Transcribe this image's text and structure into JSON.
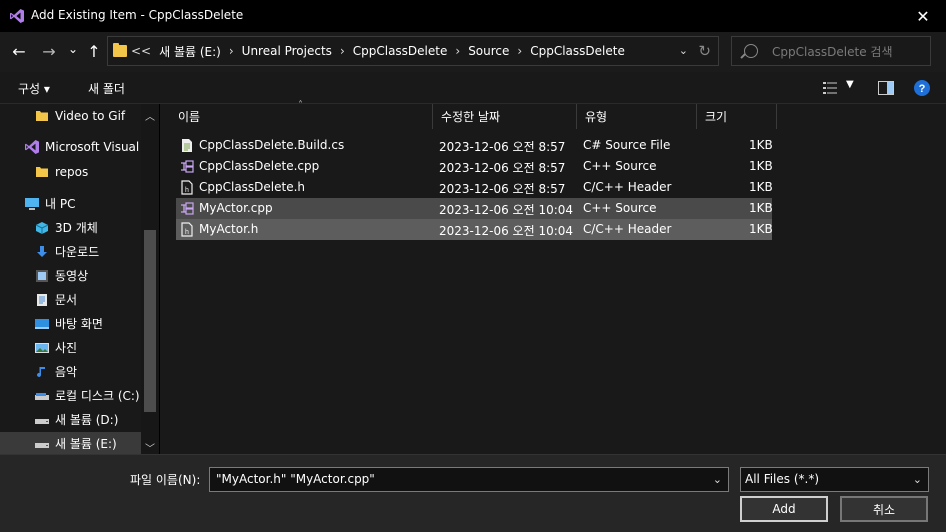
{
  "window": {
    "title": "Add Existing Item - CppClassDelete",
    "close": "✕"
  },
  "nav": {
    "back": "←",
    "forward": "→",
    "recent": "⌄",
    "up": "↑",
    "breadcrumb": [
      "<<",
      "새 볼륨 (E:)",
      "Unreal Projects",
      "CppClassDelete",
      "Source",
      "CppClassDelete"
    ],
    "search_placeholder": "CppClassDelete 검색"
  },
  "toolbar": {
    "organize": "구성 ▾",
    "new_folder": "새 폴더"
  },
  "sidebar": {
    "items": [
      {
        "label": "Video to Gif",
        "icon": "folder-icon"
      },
      {
        "label": "Microsoft Visual S",
        "icon": "vs-icon"
      },
      {
        "label": "repos",
        "icon": "folder-icon"
      },
      {
        "label": "내 PC",
        "icon": "pc-icon"
      },
      {
        "label": "3D 개체",
        "icon": "cube-icon"
      },
      {
        "label": "다운로드",
        "icon": "download-icon"
      },
      {
        "label": "동영상",
        "icon": "video-icon"
      },
      {
        "label": "문서",
        "icon": "document-icon"
      },
      {
        "label": "바탕 화면",
        "icon": "desktop-icon"
      },
      {
        "label": "사진",
        "icon": "picture-icon"
      },
      {
        "label": "음악",
        "icon": "music-icon"
      },
      {
        "label": "로컬 디스크 (C:)",
        "icon": "drive-icon"
      },
      {
        "label": "새 볼륨 (D:)",
        "icon": "drive-icon"
      },
      {
        "label": "새 볼륨 (E:)",
        "icon": "drive-icon"
      }
    ]
  },
  "columns": {
    "name": "이름",
    "date": "수정한 날짜",
    "type": "유형",
    "size": "크기"
  },
  "files": [
    {
      "name": "CppClassDelete.Build.cs",
      "date": "2023-12-06 오전 8:57",
      "type": "C# Source File",
      "size": "1KB",
      "icon": "cs-file-icon"
    },
    {
      "name": "CppClassDelete.cpp",
      "date": "2023-12-06 오전 8:57",
      "type": "C++ Source",
      "size": "1KB",
      "icon": "cpp-file-icon"
    },
    {
      "name": "CppClassDelete.h",
      "date": "2023-12-06 오전 8:57",
      "type": "C/C++ Header",
      "size": "1KB",
      "icon": "h-file-icon"
    },
    {
      "name": "MyActor.cpp",
      "date": "2023-12-06 오전 10:04",
      "type": "C++ Source",
      "size": "1KB",
      "icon": "cpp-file-icon"
    },
    {
      "name": "MyActor.h",
      "date": "2023-12-06 오전 10:04",
      "type": "C/C++ Header",
      "size": "1KB",
      "icon": "h-file-icon"
    }
  ],
  "bottom": {
    "filename_label": "파일 이름(N):",
    "filename_value": "\"MyActor.h\" \"MyActor.cpp\"",
    "filetype_value": "All Files (*.*)",
    "add_label": "Add",
    "cancel_label": "취소"
  }
}
